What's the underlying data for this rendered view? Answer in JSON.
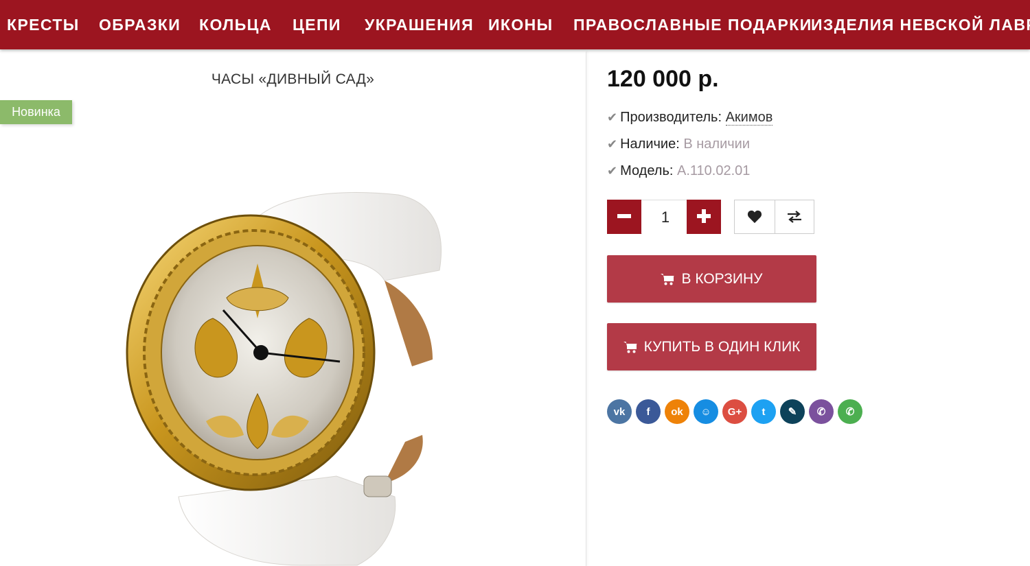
{
  "nav": {
    "items": [
      {
        "label": "КРЕСТЫ"
      },
      {
        "label": "ОБРАЗКИ"
      },
      {
        "label": "КОЛЬЦА"
      },
      {
        "label": "ЦЕПИ"
      },
      {
        "label": "УКРАШЕНИЯ"
      },
      {
        "label": "ИКОНЫ"
      },
      {
        "label": "ПРАВОСЛАВНЫЕ ПОДАРКИ"
      },
      {
        "label": "ИЗДЕЛИЯ НЕВСКОЙ ЛАВРЫ"
      }
    ]
  },
  "product": {
    "title": "ЧАСЫ «ДИВНЫЙ САД»",
    "badge": "Новинка",
    "price": "120 000 р.",
    "specs": [
      {
        "label": "Производитель:",
        "value": "Акимов"
      },
      {
        "label": "Наличие:",
        "value": "В наличии"
      },
      {
        "label": "Модель:",
        "value": "А.110.02.01"
      }
    ],
    "quantity": "1",
    "add_to_cart": "В КОРЗИНУ",
    "buy_one_click": "КУПИТЬ В ОДИН КЛИК"
  },
  "share": [
    {
      "icon": "vk-icon",
      "glyph": "vk",
      "color": "#4c75a3"
    },
    {
      "icon": "facebook-icon",
      "glyph": "f",
      "color": "#3b5998"
    },
    {
      "icon": "odnoklassniki-icon",
      "glyph": "ok",
      "color": "#ee8208"
    },
    {
      "icon": "moimir-icon",
      "glyph": "☺",
      "color": "#168de2"
    },
    {
      "icon": "google-plus-icon",
      "glyph": "G+",
      "color": "#dc4e41"
    },
    {
      "icon": "twitter-icon",
      "glyph": "t",
      "color": "#1da1f2"
    },
    {
      "icon": "livejournal-icon",
      "glyph": "✎",
      "color": "#0d425a"
    },
    {
      "icon": "viber-icon",
      "glyph": "✆",
      "color": "#7b519d"
    },
    {
      "icon": "whatsapp-icon",
      "glyph": "✆",
      "color": "#4caf50"
    }
  ],
  "colors": {
    "brand": "#9c1520",
    "button": "#b33a47",
    "badge": "#8cba6a"
  }
}
